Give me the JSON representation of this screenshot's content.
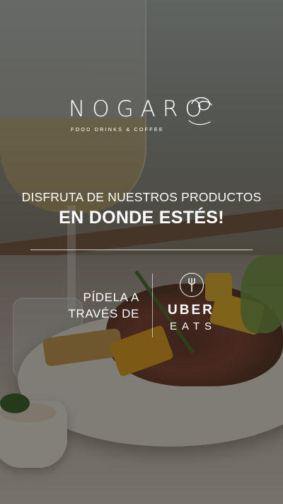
{
  "brand": {
    "logo_text": "NOGARO",
    "tagline": "FOOD DRINKS & COFFEE"
  },
  "headline": {
    "line1": "DISFRUTA DE NUESTROS PRODUCTOS",
    "line2": "EN DONDE ESTÉS!"
  },
  "order": {
    "line1": "PÍDELA A",
    "line2": "TRAVÉS DE"
  },
  "partner": {
    "name_top": "UBER",
    "name_bottom": "EATS",
    "icon": "fork-icon"
  },
  "colors": {
    "text": "#ffffff",
    "overlay": "#1c1814"
  }
}
